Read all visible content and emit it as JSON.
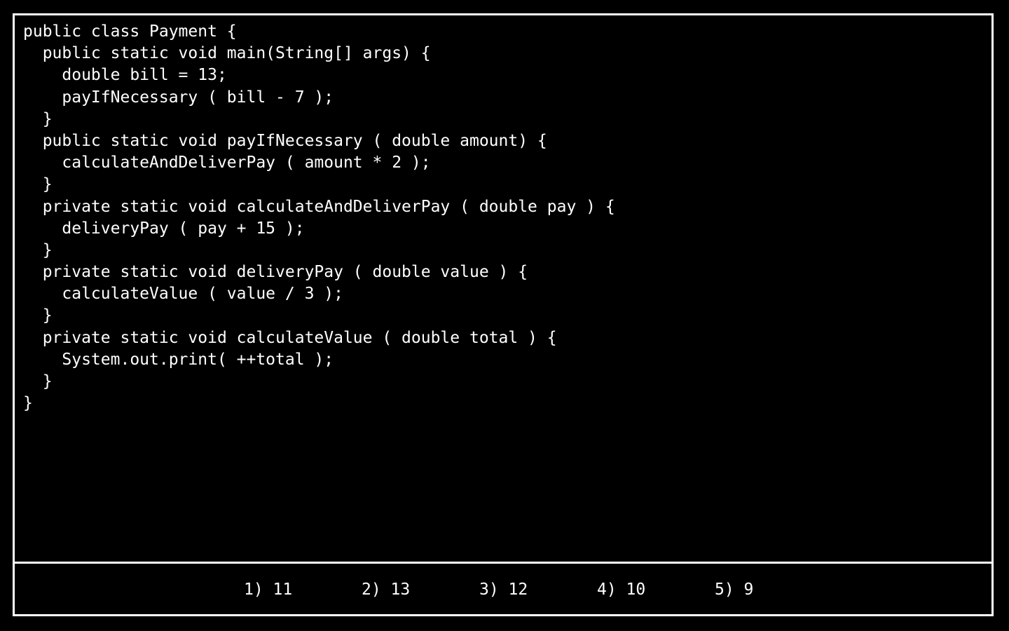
{
  "code": {
    "lines": [
      "public class Payment {",
      "  public static void main(String[] args) {",
      "    double bill = 13;",
      "    payIfNecessary ( bill - 7 );",
      "  }",
      "  public static void payIfNecessary ( double amount) {",
      "    calculateAndDeliverPay ( amount * 2 );",
      "  }",
      "  private static void calculateAndDeliverPay ( double pay ) {",
      "    deliveryPay ( pay + 15 );",
      "  }",
      "  private static void deliveryPay ( double value ) {",
      "    calculateValue ( value / 3 );",
      "  }",
      "  private static void calculateValue ( double total ) {",
      "    System.out.print( ++total );",
      "  }",
      "}"
    ]
  },
  "answers": [
    {
      "label": "1) 11"
    },
    {
      "label": "2) 13"
    },
    {
      "label": "3) 12"
    },
    {
      "label": "4) 10"
    },
    {
      "label": "5) 9"
    }
  ],
  "colors": {
    "background": "#000000",
    "text": "#ffffff",
    "border": "#ffffff"
  }
}
